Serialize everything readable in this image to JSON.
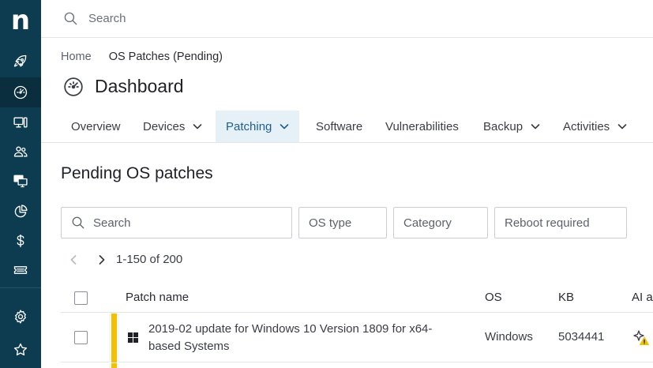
{
  "sidebar": {
    "logo": "n",
    "items": [
      {
        "icon": "rocket-icon"
      },
      {
        "icon": "dashboard-gauge-icon"
      },
      {
        "icon": "devices-icon"
      },
      {
        "icon": "users-icon"
      },
      {
        "icon": "remote-screens-icon"
      },
      {
        "icon": "pie-chart-icon"
      },
      {
        "icon": "dollar-icon"
      },
      {
        "icon": "ticket-icon"
      },
      {
        "icon": "settings-gear-icon"
      },
      {
        "icon": "star-icon"
      }
    ],
    "active_item": "dashboard-gauge-icon"
  },
  "search": {
    "placeholder": "Search"
  },
  "breadcrumb": {
    "home": "Home",
    "current": "OS Patches (Pending)"
  },
  "page": {
    "title": "Dashboard"
  },
  "tabs": [
    {
      "label": "Overview",
      "has_menu": false
    },
    {
      "label": "Devices",
      "has_menu": true
    },
    {
      "label": "Patching",
      "has_menu": true,
      "active": true
    },
    {
      "label": "Software",
      "has_menu": false
    },
    {
      "label": "Vulnerabilities",
      "has_menu": false
    },
    {
      "label": "Backup",
      "has_menu": true
    },
    {
      "label": "Activities",
      "has_menu": true
    }
  ],
  "section": {
    "title": "Pending OS patches"
  },
  "filters": {
    "search_placeholder": "Search",
    "os_type": "OS type",
    "category": "Category",
    "reboot_required": "Reboot required"
  },
  "pagination": {
    "range": "1-150 of 200"
  },
  "table": {
    "columns": [
      "Patch name",
      "OS",
      "KB",
      "AI a"
    ],
    "rows": [
      {
        "patch_name": "2019-02 update for Windows 10 Version 1809 for x64-based Systems",
        "os": "Windows",
        "kb": "5034441",
        "severity_color": "#f2c200"
      }
    ]
  },
  "colors": {
    "sidebar_bg": "#0d3b4f",
    "active_tab_bg": "#e6f0f7",
    "active_tab_text": "#1f5f8f",
    "severity_yellow": "#f2c200"
  }
}
